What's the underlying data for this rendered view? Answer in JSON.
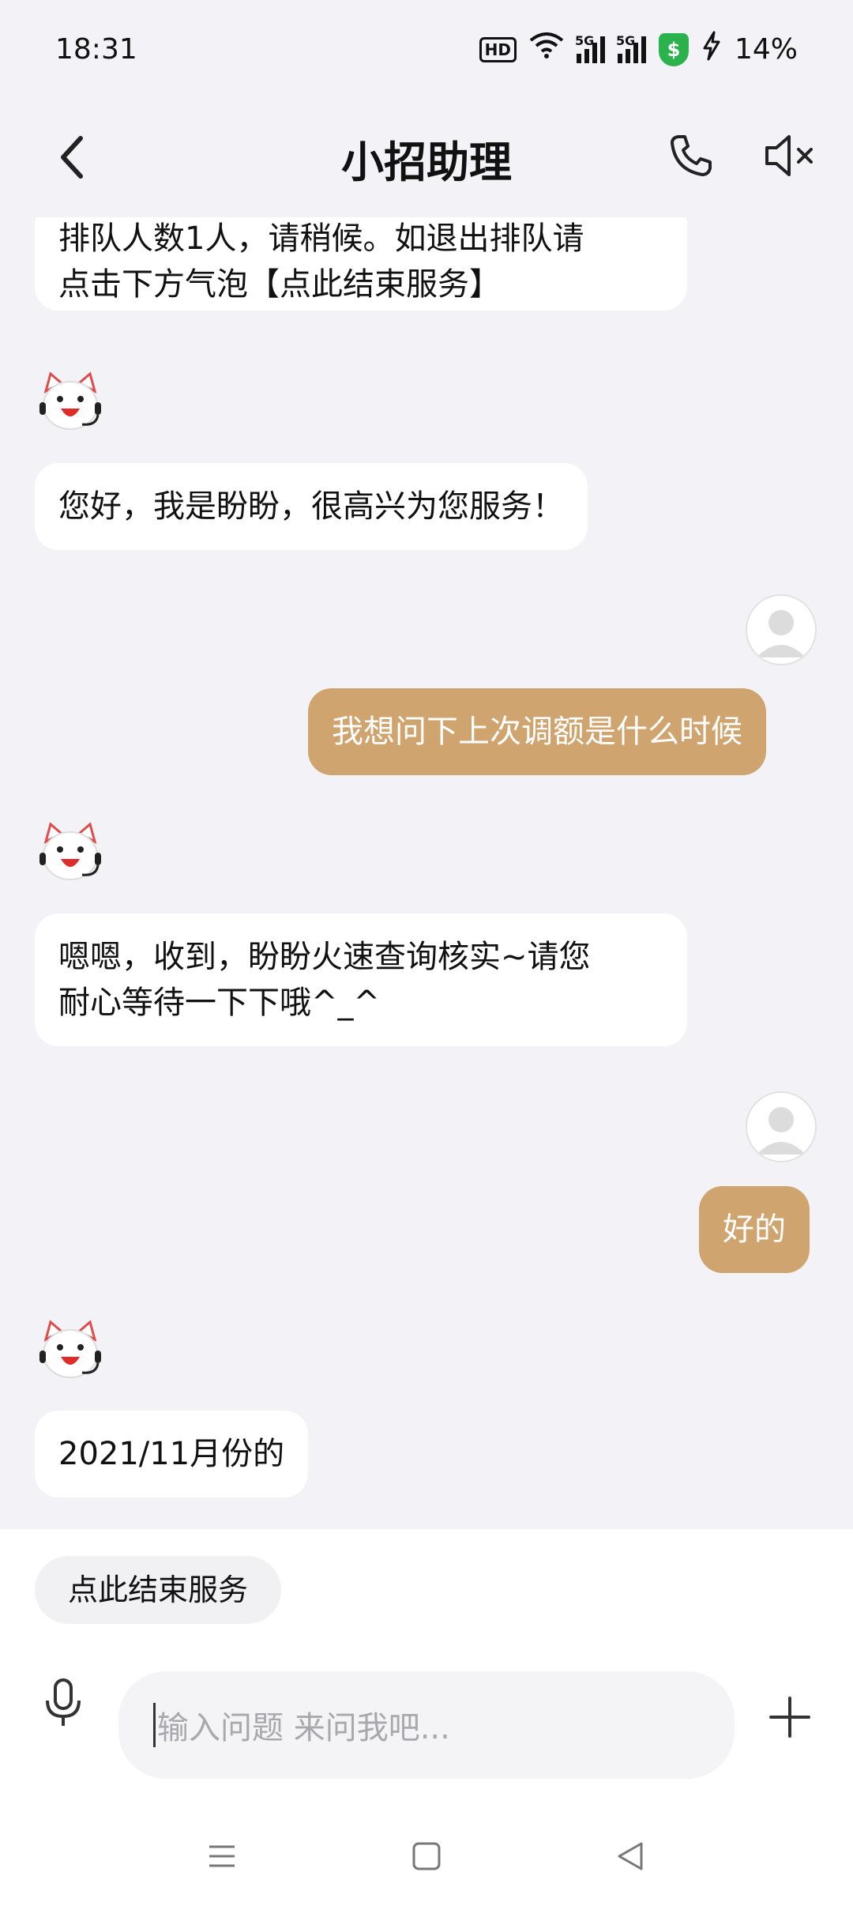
{
  "status_bar": {
    "time": "18:31",
    "hd_badge": "HD",
    "signal1_tag": "5G",
    "signal2_tag": "5G",
    "shield_symbol": "$",
    "battery": "14%",
    "icons": [
      "wifi-icon",
      "signal-icon",
      "signal-icon",
      "security-shield-icon",
      "charging-bolt-icon"
    ]
  },
  "header": {
    "title": "小招助理",
    "icons": [
      "back-icon",
      "phone-icon",
      "speaker-mute-icon"
    ]
  },
  "messages": [
    {
      "from": "bot",
      "text": "排队人数1人，请稍候。如退出排队请\n点击下方气泡【点此结束服务】",
      "avatar": false
    },
    {
      "from": "bot",
      "text": "您好，我是盼盼，很高兴为您服务！",
      "avatar": true
    },
    {
      "from": "user",
      "text": "我想问下上次调额是什么时候",
      "avatar": true
    },
    {
      "from": "bot",
      "text": "嗯嗯，收到，盼盼火速查询核实~请您\n耐心等待一下下哦^_^",
      "avatar": true
    },
    {
      "from": "user",
      "text": "好的",
      "avatar": true
    },
    {
      "from": "bot",
      "text": "2021/11月份的",
      "avatar": true
    }
  ],
  "quick_reply": {
    "label": "点此结束服务"
  },
  "input": {
    "placeholder": "输入问题 来问我吧..."
  },
  "colors": {
    "background": "#f2f2f7",
    "user_bubble": "#cfa46e",
    "bot_bubble": "#ffffff",
    "shield": "#2bb24c"
  }
}
